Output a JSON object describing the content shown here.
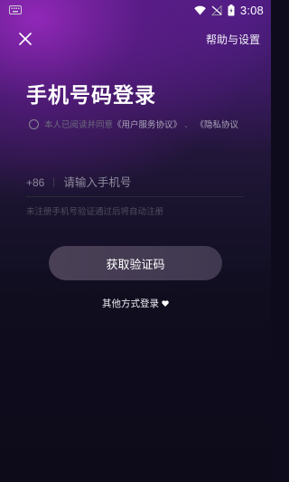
{
  "status_bar": {
    "time": "3:08",
    "icons": [
      "keyboard-icon",
      "wifi-icon",
      "signal-off-icon",
      "battery-icon"
    ]
  },
  "header": {
    "close_icon": "close-icon",
    "help_link": "帮助与设置"
  },
  "title": "手机号码登录",
  "agreement": {
    "prefix": "本人已阅读并同意",
    "user_agreement": "《用户服务协议》",
    "separator": "、",
    "privacy_agreement": "《隐私协议"
  },
  "phone": {
    "country_code": "+86",
    "value": "",
    "placeholder": "请输入手机号"
  },
  "hint": "未注册手机号验证通过后将自动注册",
  "get_code_button": "获取验证码",
  "other_login": "其他方式登录",
  "colors": {
    "accent_purple": "#8a2cb8",
    "background": "#0e0c1c",
    "button": "#463e53"
  }
}
